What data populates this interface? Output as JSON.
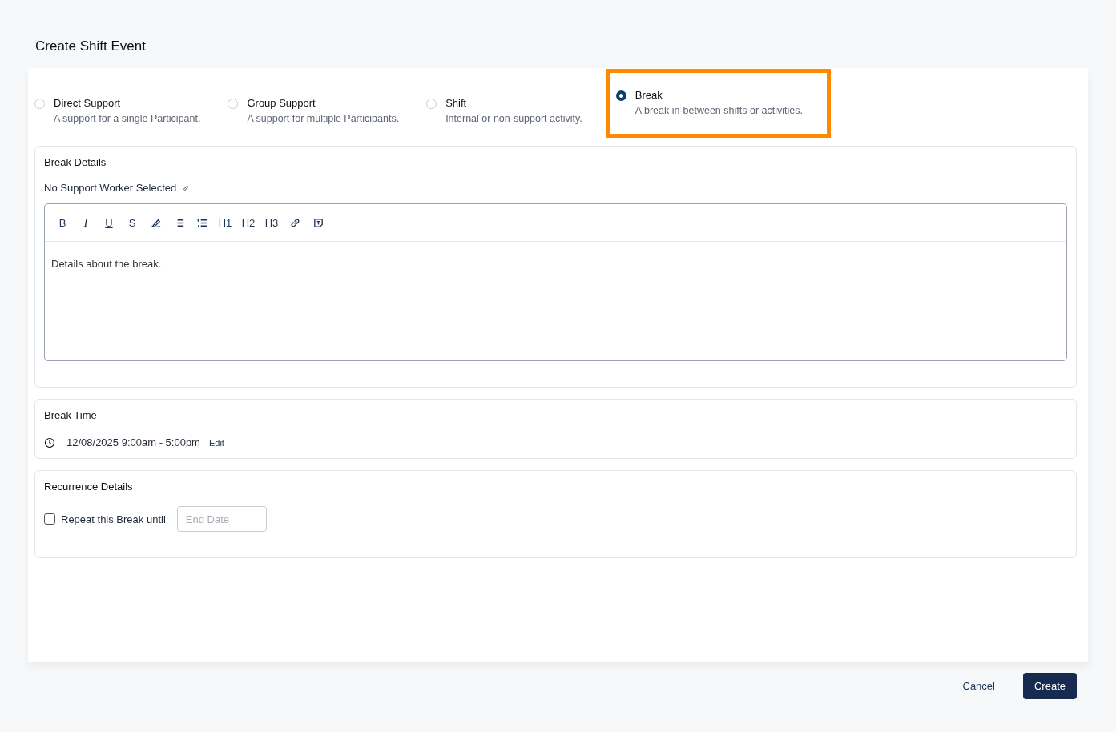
{
  "title": "Create Shift Event",
  "event_types": [
    {
      "label": "Direct Support",
      "description": "A support for a single Participant.",
      "selected": false,
      "highlighted": false
    },
    {
      "label": "Group Support",
      "description": "A support for multiple Participants.",
      "selected": false,
      "highlighted": false
    },
    {
      "label": "Shift",
      "description": "Internal or non-support activity.",
      "selected": false,
      "highlighted": false
    },
    {
      "label": "Break",
      "description": "A break in-between shifts or activities.",
      "selected": true,
      "highlighted": true
    }
  ],
  "details": {
    "heading": "Break Details",
    "worker": "No Support Worker Selected",
    "toolbar": [
      {
        "kind": "bold",
        "label": "B"
      },
      {
        "kind": "italic",
        "label": "I"
      },
      {
        "kind": "underline",
        "label": "U"
      },
      {
        "kind": "strike",
        "label": "S"
      },
      {
        "kind": "highlight"
      },
      {
        "kind": "bullets"
      },
      {
        "kind": "numbered"
      },
      {
        "kind": "heading",
        "label": "H1"
      },
      {
        "kind": "heading",
        "label": "H2"
      },
      {
        "kind": "heading",
        "label": "H3"
      },
      {
        "kind": "link"
      },
      {
        "kind": "textbox"
      }
    ],
    "body": "Details about the break."
  },
  "time": {
    "heading": "Break Time",
    "value": "12/08/2025 9:00am - 5:00pm",
    "edit": "Edit"
  },
  "recurrence": {
    "heading": "Recurrence Details",
    "label": "Repeat this Break until",
    "checked": false,
    "end_date": {
      "placeholder": "End Date"
    }
  },
  "buttons": {
    "cancel": "Cancel",
    "create": "Create"
  }
}
